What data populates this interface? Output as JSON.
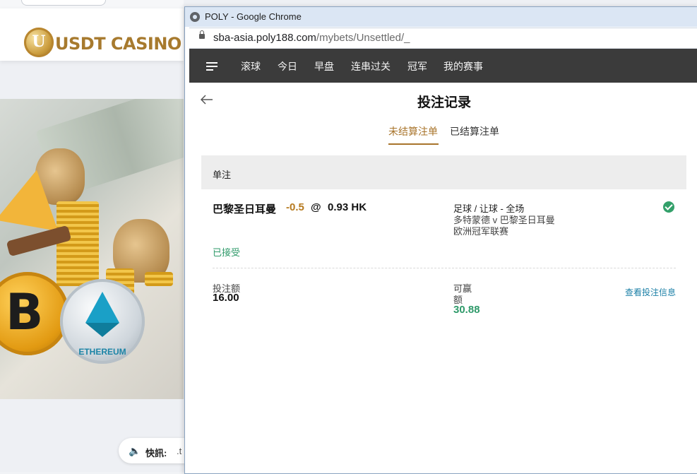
{
  "background_site": {
    "logo_letter": "U",
    "logo_text": "USDT CASINO",
    "hero": {
      "ethereum_label": "ETHEREUM"
    },
    "ticker": {
      "speaker_icon": "speaker-icon",
      "label": "快訊:",
      "text": ".t"
    }
  },
  "browser": {
    "title": "POLY - Google Chrome",
    "url_host": "sba-asia.poly188.com",
    "url_path": "/mybets/Unsettled/_"
  },
  "nav": {
    "items": [
      "滚球",
      "今日",
      "早盘",
      "连串过关",
      "冠军",
      "我的赛事"
    ]
  },
  "page": {
    "title": "投注记录",
    "tabs": [
      {
        "label": "未结算注单",
        "active": true
      },
      {
        "label": "已结算注单",
        "active": false
      }
    ],
    "section_title": "单注"
  },
  "bet": {
    "selection": "巴黎圣日耳曼",
    "handicap": "-0.5",
    "at": "@",
    "odds": "0.93 HK",
    "market": "足球 / 让球 - 全场",
    "match": "多特蒙德 v 巴黎圣日耳曼",
    "league": "欧洲冠军联赛",
    "status": "已接受",
    "stake_label": "投注额",
    "stake_value": "16.00",
    "win_label_line1": "可赢",
    "win_label_line2": "额",
    "win_value": "30.88",
    "details_link": "查看投注信息"
  },
  "colors": {
    "accent_gold": "#a8742b",
    "handicap": "#b67a1f",
    "success_green": "#2f9a6a",
    "link_blue": "#1a7fa6",
    "navbar": "#3b3b3b"
  }
}
